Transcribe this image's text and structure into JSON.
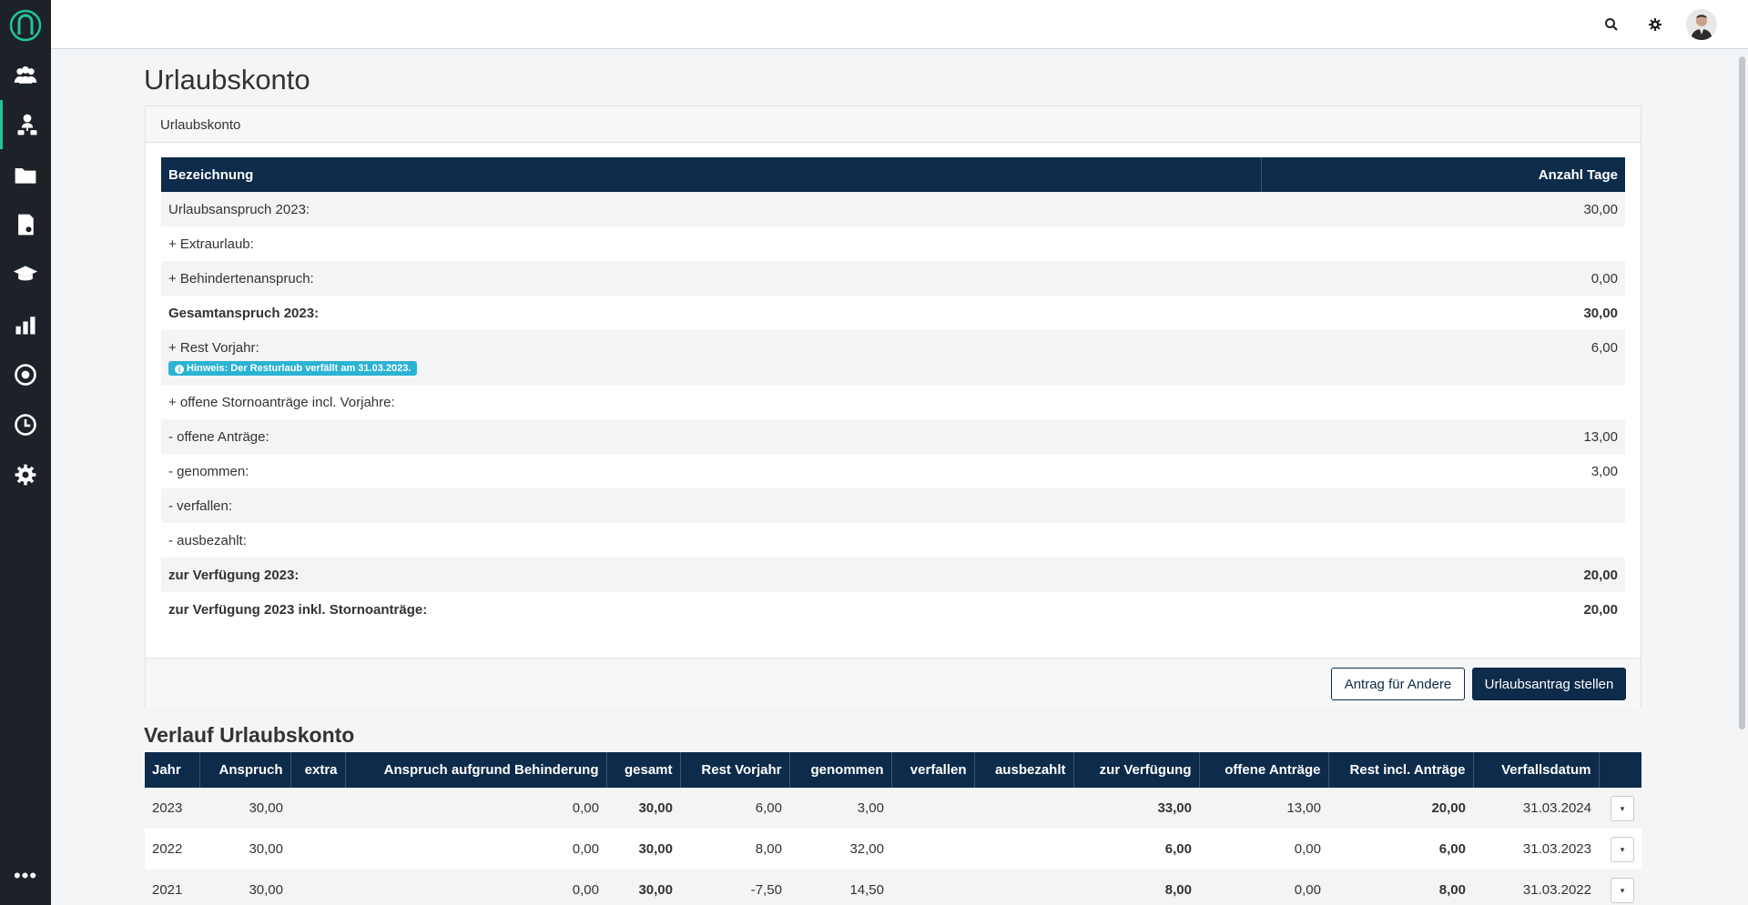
{
  "page": {
    "title": "Urlaubskonto"
  },
  "nav": {
    "items": [
      {
        "icon": "users-group-icon"
      },
      {
        "icon": "user-org-icon",
        "active": true
      },
      {
        "icon": "folder-icon"
      },
      {
        "icon": "document-icon"
      },
      {
        "icon": "graduation-cap-icon"
      },
      {
        "icon": "bar-chart-icon"
      },
      {
        "icon": "support-icon"
      },
      {
        "icon": "clock-icon"
      },
      {
        "icon": "settings-icon"
      }
    ],
    "more": "•••"
  },
  "panel": {
    "header": "Urlaubskonto",
    "columns": {
      "label": "Bezeichnung",
      "days": "Anzahl Tage"
    },
    "rows": [
      {
        "label": "Urlaubsanspruch 2023:",
        "value": "30,00"
      },
      {
        "label": "+ Extraurlaub:",
        "value": ""
      },
      {
        "label": "+ Behindertenanspruch:",
        "value": "0,00"
      },
      {
        "label": "Gesamtanspruch 2023:",
        "value": "30,00"
      },
      {
        "label": "+ Rest Vorjahr:",
        "value": "6,00",
        "hint": "Hinweis: Der Resturlaub verfällt am 31.03.2023."
      },
      {
        "label": "+ offene Stornoanträge incl. Vorjahre:",
        "value": ""
      },
      {
        "label": "- offene Anträge:",
        "value": "13,00"
      },
      {
        "label": "- genommen:",
        "value": "3,00"
      },
      {
        "label": "- verfallen:",
        "value": ""
      },
      {
        "label": "- ausbezahlt:",
        "value": ""
      },
      {
        "label": "zur Verfügung 2023:",
        "value": "20,00"
      },
      {
        "label": "zur Verfügung 2023 inkl. Stornoanträge:",
        "value": "20,00"
      }
    ],
    "buttons": {
      "secondary": "Antrag für Andere",
      "primary": "Urlaubsantrag stellen"
    }
  },
  "history": {
    "title": "Verlauf Urlaubskonto",
    "columns": [
      "Jahr",
      "Anspruch",
      "extra",
      "Anspruch aufgrund Behinderung",
      "gesamt",
      "Rest Vorjahr",
      "genommen",
      "verfallen",
      "ausbezahlt",
      "zur Verfügung",
      "offene Anträge",
      "Rest incl. Anträge",
      "Verfallsdatum"
    ],
    "rows": [
      [
        "2023",
        "30,00",
        "",
        "0,00",
        "30,00",
        "6,00",
        "3,00",
        "",
        "",
        "33,00",
        "13,00",
        "20,00",
        "31.03.2024"
      ],
      [
        "2022",
        "30,00",
        "",
        "0,00",
        "30,00",
        "8,00",
        "32,00",
        "",
        "",
        "6,00",
        "0,00",
        "6,00",
        "31.03.2023"
      ],
      [
        "2021",
        "30,00",
        "",
        "0,00",
        "30,00",
        "-7,50",
        "14,50",
        "",
        "",
        "8,00",
        "0,00",
        "8,00",
        "31.03.2022"
      ]
    ],
    "row_action": "▾"
  },
  "colors": {
    "primary": "#0d2b4a",
    "sidebar": "#1d2228",
    "accent": "#22c39a",
    "hint": "#2bb3d3"
  }
}
